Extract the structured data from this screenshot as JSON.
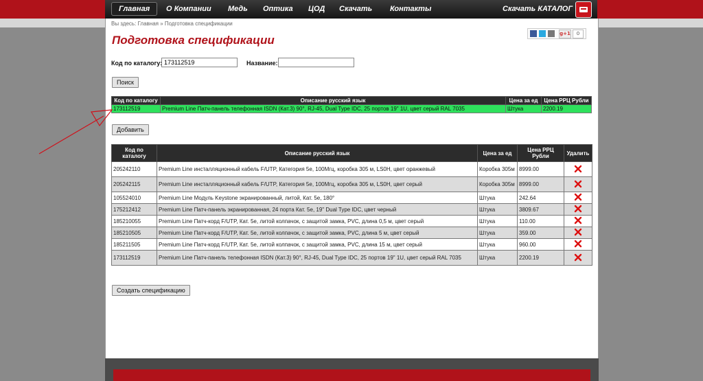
{
  "nav": {
    "items": [
      "Главная",
      "О Компании",
      "Медь",
      "Оптика",
      "ЦОД",
      "Скачать",
      "Контакты"
    ],
    "download_catalog": "Скачать КАТАЛОГ"
  },
  "breadcrumb": "Вы здесь: Главная » Подготовка спецификации",
  "share": {
    "plus": "g+1",
    "count": "0"
  },
  "page_title": "Подготовка спецификации",
  "search": {
    "code_label": "Код по каталогу:",
    "code_value": "173112519",
    "name_label": "Название:",
    "name_value": "",
    "button": "Поиск"
  },
  "result": {
    "headers": [
      "Код по каталогу",
      "Описание русский язык",
      "Цена за ед",
      "Цена РРЦ Рубли"
    ],
    "row": [
      "173112519",
      "Premium Line Патч-панель телефонная ISDN (Кат.3) 90°, RJ-45, Dual Type IDC, 25 портов 19\" 1U, цвет серый RAL 7035",
      "Штука",
      "2200.19"
    ],
    "add_button": "Добавить"
  },
  "spec": {
    "headers": [
      "Код по каталогу",
      "Описание русский язык",
      "Цена за ед",
      "Цена РРЦ Рубли",
      "Удалить"
    ],
    "rows": [
      [
        "205242110",
        "Premium Line инсталляционный кабель F/UTP, Категория 5e, 100Мгц, коробка 305 м, LS0H, цвет оранжевый",
        "Коробка 305м",
        "8999.00"
      ],
      [
        "205242115",
        "Premium Line инсталляционный кабель F/UTP, Категория 5e, 100Мгц, коробка 305 м, LS0H, цвет серый",
        "Коробка 305м",
        "8999.00"
      ],
      [
        "105524010",
        "Premium Line Модуль Keystone экранированный, литой, Кат. 5е, 180°",
        "Штука",
        "242.64"
      ],
      [
        "175212412",
        "Premium Line Патч-панель экранированная, 24 порта Кат. 5е, 19\" Dual Type IDC, цвет черный",
        "Штука",
        "3809.67"
      ],
      [
        "185210055",
        "Premium Line Патч-корд F/UTP, Кат. 5е, литой колпачок, с защитой замка, PVC, длина 0,5 м, цвет серый",
        "Штука",
        "110.00"
      ],
      [
        "185210505",
        "Premium Line Патч-корд F/UTP, Кат. 5е, литой колпачок, с защитой замка, PVC, длина 5 м, цвет серый",
        "Штука",
        "359.00"
      ],
      [
        "185211505",
        "Premium Line Патч-корд F/UTP, Кат. 5е, литой колпачок, с защитой замка, PVC, длина 15 м, цвет серый",
        "Штука",
        "960.00"
      ],
      [
        "173112519",
        "Premium Line Патч-панель телефонная ISDN (Кат.3) 90°, RJ-45, Dual Type IDC, 25 портов 19\" 1U, цвет серый RAL 7035",
        "Штука",
        "2200.19"
      ]
    ],
    "create_button": "Создать спецификацию"
  },
  "colors": {
    "brand_red": "#b0121a",
    "result_green": "#2ee15c",
    "header_dark": "#2c2c2c"
  }
}
